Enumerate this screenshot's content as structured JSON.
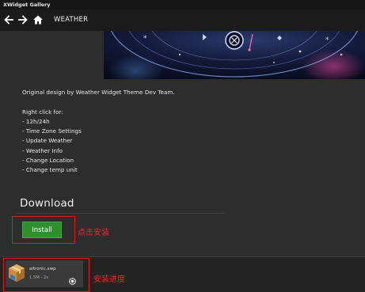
{
  "app": {
    "window_title": "XWidget Gallery"
  },
  "toolbar": {
    "back_icon": "arrow-left-icon",
    "forward_icon": "arrow-right-icon",
    "home_icon": "home-icon",
    "page_title": "WEATHER"
  },
  "description": {
    "credit": "Original design by Weather Widget Theme Dev Team.",
    "right_click_heading": "Right click for:",
    "options": [
      "- 12h/24h",
      "- Time Zone Settings",
      "- Update Weather",
      "- Weather Info",
      "- Change Location",
      "- Change temp unit"
    ]
  },
  "download": {
    "heading": "Download",
    "install_label": "Install",
    "install_annotation": "点击安装"
  },
  "download_bar": {
    "file_name": "aitronic.xwp",
    "file_progress": "1.5M - 2s",
    "package_icon": "package-icon",
    "cancel_icon": "cancel-circle-icon",
    "progress_annotation": "安装进度"
  },
  "colors": {
    "install_green": "#2f8f2f",
    "annotation_red": "#e11b1b"
  }
}
